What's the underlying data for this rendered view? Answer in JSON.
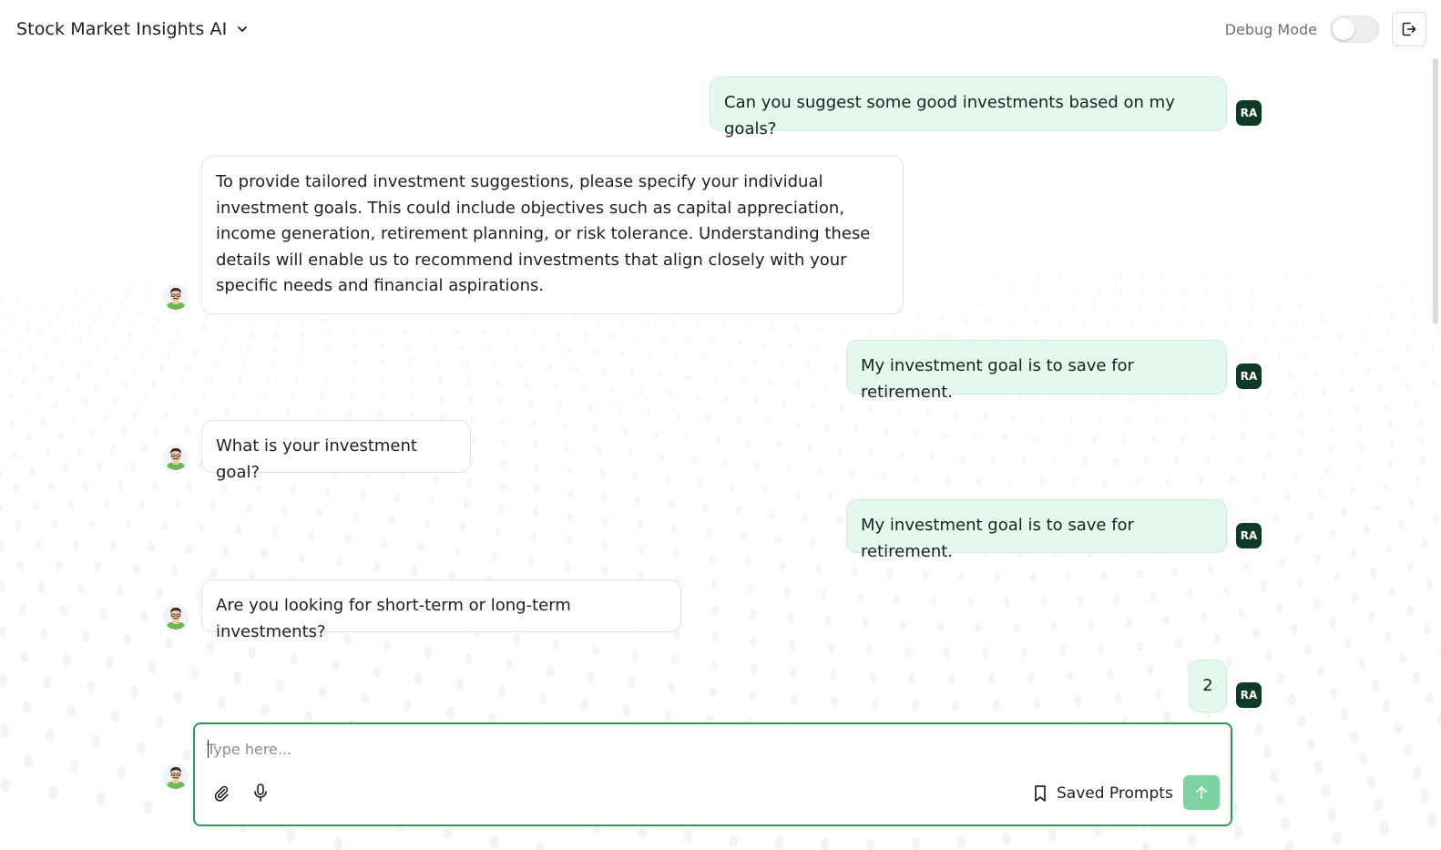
{
  "header": {
    "app_title": "Stock Market Insights AI",
    "debug_label": "Debug Mode",
    "debug_enabled": false
  },
  "user": {
    "initials": "RA"
  },
  "messages": [
    {
      "role": "user",
      "text": "Can you suggest some good investments based on my goals?"
    },
    {
      "role": "bot",
      "text": "To provide tailored investment suggestions, please specify your individual investment goals. This could include objectives such as capital appreciation, income generation, retirement planning, or risk tolerance. Understanding these details will enable us to recommend investments that align closely with your specific needs and financial aspirations."
    },
    {
      "role": "user",
      "text": "My investment goal is to save for retirement."
    },
    {
      "role": "bot",
      "text": "What is your investment goal?"
    },
    {
      "role": "user",
      "text": "My investment goal is to save for retirement."
    },
    {
      "role": "bot",
      "text": "Are you looking for short-term or long-term investments?"
    },
    {
      "role": "user",
      "text": "2"
    }
  ],
  "composer": {
    "placeholder": "Type here...",
    "value": "",
    "saved_prompts_label": "Saved Prompts"
  },
  "icons": {
    "dropdown": "chevron-down-icon",
    "logout": "logout-icon",
    "attach": "paperclip-icon",
    "mic": "microphone-icon",
    "bookmark": "bookmark-icon",
    "send": "arrow-up-icon"
  },
  "colors": {
    "accent": "#2f9a5b",
    "user_bubble": "#e5f8ec",
    "user_avatar": "#0f3b24",
    "send_button": "#7fd3a1"
  }
}
